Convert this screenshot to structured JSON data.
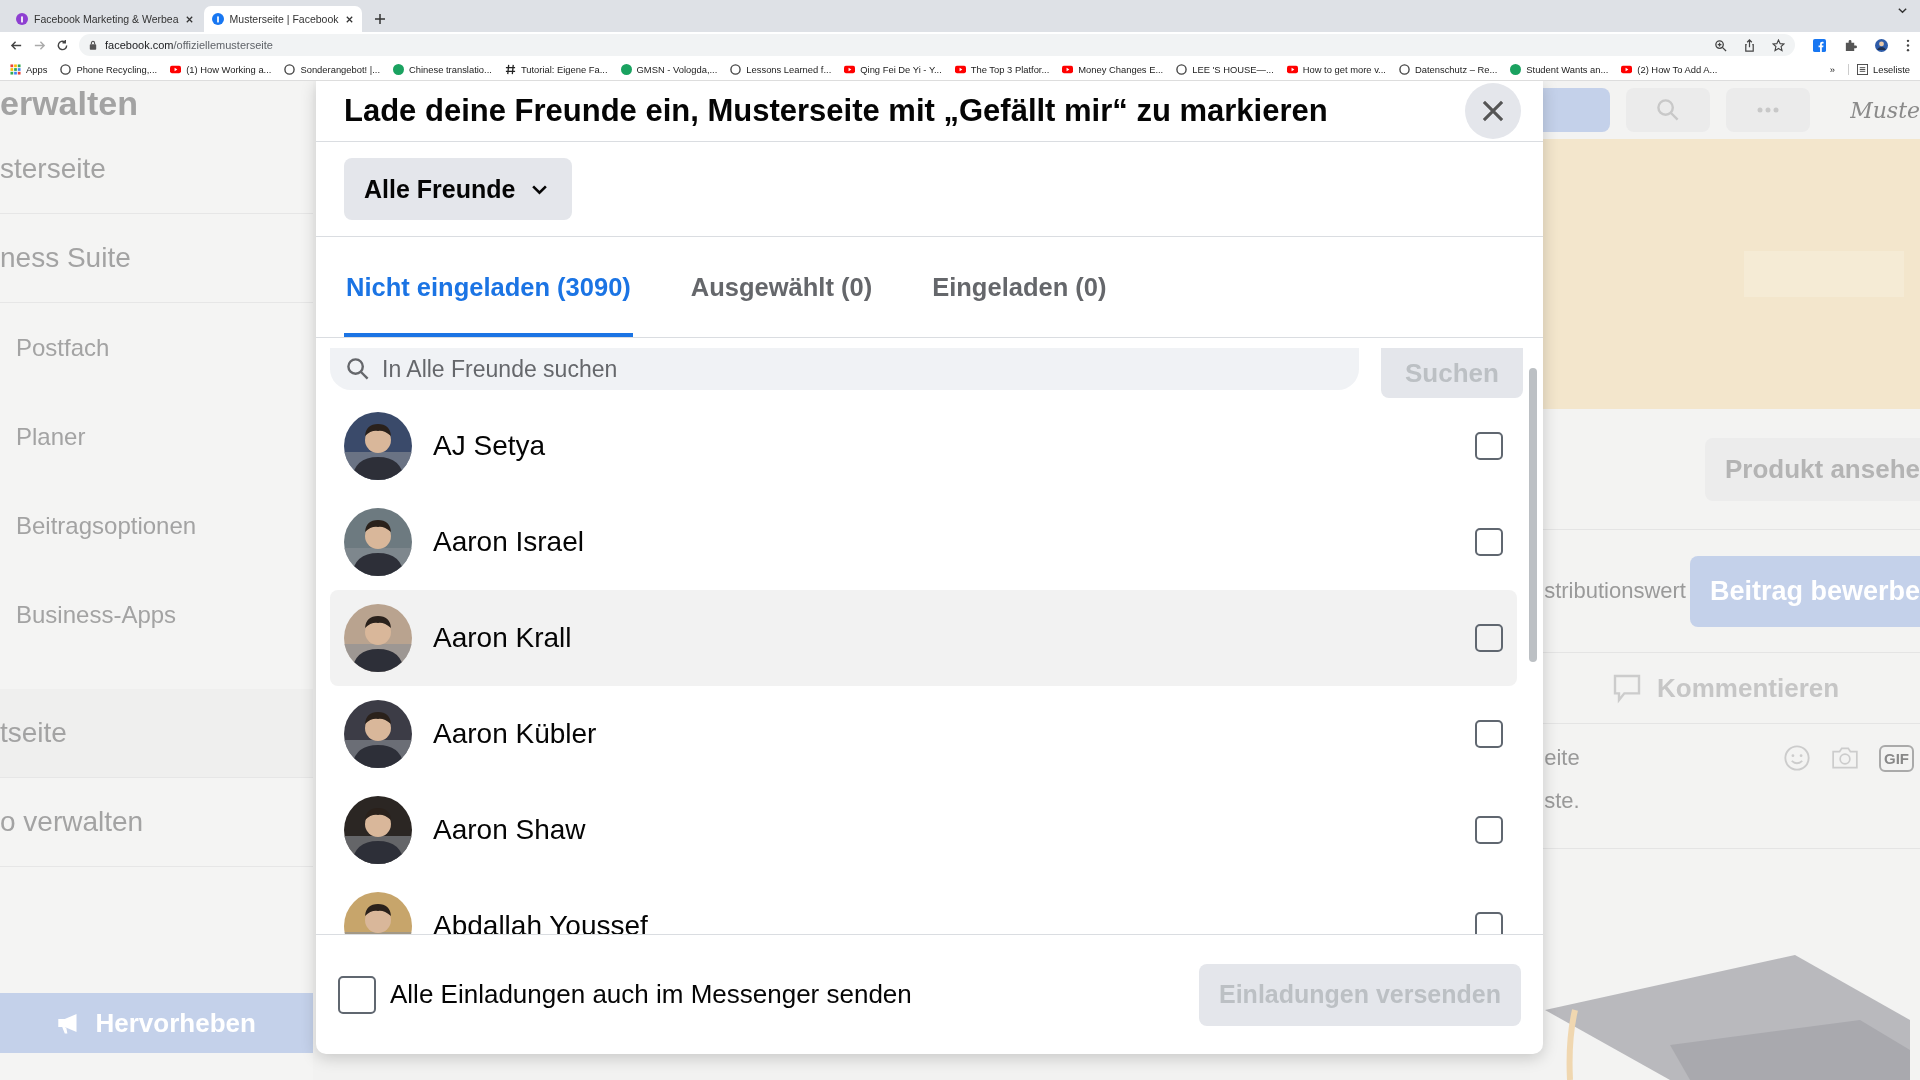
{
  "browser": {
    "tabs": [
      {
        "title": "Facebook Marketing & Werbea",
        "selected": false
      },
      {
        "title": "Musterseite | Facebook",
        "selected": true
      }
    ],
    "url_host": "facebook.com",
    "url_path": "/offiziellemusterseite",
    "apps_label": "Apps",
    "bookmarks": [
      {
        "label": "Phone Recycling,...",
        "kind": "mark"
      },
      {
        "label": "(1) How Working a...",
        "kind": "youtube"
      },
      {
        "label": "Sonderangebot! |...",
        "kind": "mark"
      },
      {
        "label": "Chinese translatio...",
        "kind": "dot"
      },
      {
        "label": "Tutorial: Eigene Fa...",
        "kind": "hash"
      },
      {
        "label": "GMSN - Vologda,...",
        "kind": "dot"
      },
      {
        "label": "Lessons Learned f...",
        "kind": "mark"
      },
      {
        "label": "Qing Fei De Yi - Y...",
        "kind": "youtube"
      },
      {
        "label": "The Top 3 Platfor...",
        "kind": "youtube"
      },
      {
        "label": "Money Changes E...",
        "kind": "youtube"
      },
      {
        "label": "LEE 'S HOUSE—...",
        "kind": "mark"
      },
      {
        "label": "How to get more v...",
        "kind": "youtube"
      },
      {
        "label": "Datenschutz – Re...",
        "kind": "mark"
      },
      {
        "label": "Student Wants an...",
        "kind": "dot"
      },
      {
        "label": "(2) How To Add A...",
        "kind": "youtube"
      }
    ],
    "overflow": "»",
    "reading_list": "Leseliste"
  },
  "background": {
    "sidebar": [
      {
        "label": "erwalten",
        "kind": "heading"
      },
      {
        "label": "sterseite",
        "kind": "section"
      },
      {
        "label": "ness Suite",
        "kind": "section"
      },
      {
        "label": "Postfach",
        "kind": "item"
      },
      {
        "label": "Planer",
        "kind": "item"
      },
      {
        "label": "Beitragsoptionen",
        "kind": "item"
      },
      {
        "label": "Business-Apps",
        "kind": "item"
      },
      {
        "label": "tseite",
        "kind": "band"
      },
      {
        "label": "o verwalten",
        "kind": "section"
      }
    ],
    "promote_button": "Hervorheben",
    "logo_text": "Muste",
    "product_button": "Produkt ansehe",
    "distribution_text": "stributionswert",
    "boost_button": "Beitrag bewerbe",
    "comment_button": "Kommentieren",
    "comment_field": "eite",
    "gif_label": "GIF",
    "note_text": "ste."
  },
  "dialog": {
    "title": "Lade deine Freunde ein, Musterseite mit „Gefällt mir“ zu markieren",
    "filter": "Alle Freunde",
    "tabs": [
      {
        "label": "Nicht eingeladen (3090)",
        "selected": true
      },
      {
        "label": "Ausgewählt (0)",
        "selected": false
      },
      {
        "label": "Eingeladen (0)",
        "selected": false
      }
    ],
    "search": {
      "placeholder": "In Alle Freunde suchen"
    },
    "search_button": "Suchen",
    "friends": [
      {
        "name": "AJ Setya",
        "checked": false,
        "hovered": false
      },
      {
        "name": "Aaron Israel",
        "checked": false,
        "hovered": false
      },
      {
        "name": "Aaron Krall",
        "checked": false,
        "hovered": true
      },
      {
        "name": "Aaron Kübler",
        "checked": false,
        "hovered": false
      },
      {
        "name": "Aaron Shaw",
        "checked": false,
        "hovered": false
      },
      {
        "name": "Abdallah Youssef",
        "checked": false,
        "hovered": false
      }
    ],
    "messenger": {
      "label": "Alle Einladungen auch im Messenger senden",
      "checked": false
    },
    "send_button": {
      "label": "Einladungen versenden",
      "disabled": true
    }
  }
}
